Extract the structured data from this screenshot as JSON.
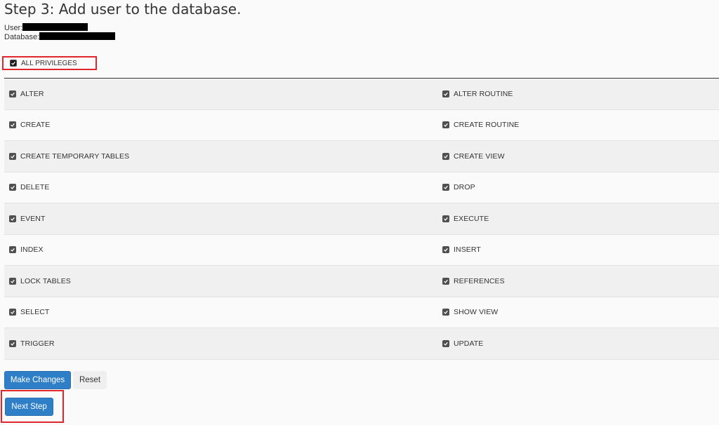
{
  "page": {
    "title": "Step 3: Add user to the database."
  },
  "meta": {
    "user_label": "User:",
    "database_label": "Database:"
  },
  "all_privileges": {
    "label": "ALL PRIVILEGES",
    "checked": true
  },
  "privileges": [
    {
      "left": "ALTER",
      "right": "ALTER ROUTINE"
    },
    {
      "left": "CREATE",
      "right": "CREATE ROUTINE"
    },
    {
      "left": "CREATE TEMPORARY TABLES",
      "right": "CREATE VIEW"
    },
    {
      "left": "DELETE",
      "right": "DROP"
    },
    {
      "left": "EVENT",
      "right": "EXECUTE"
    },
    {
      "left": "INDEX",
      "right": "INSERT"
    },
    {
      "left": "LOCK TABLES",
      "right": "REFERENCES"
    },
    {
      "left": "SELECT",
      "right": "SHOW VIEW"
    },
    {
      "left": "TRIGGER",
      "right": "UPDATE"
    }
  ],
  "actions": {
    "make_changes": "Make Changes",
    "reset": "Reset",
    "next_step": "Next Step"
  },
  "colors": {
    "primary": "#2f7fc8",
    "highlight": "#e0262b"
  }
}
